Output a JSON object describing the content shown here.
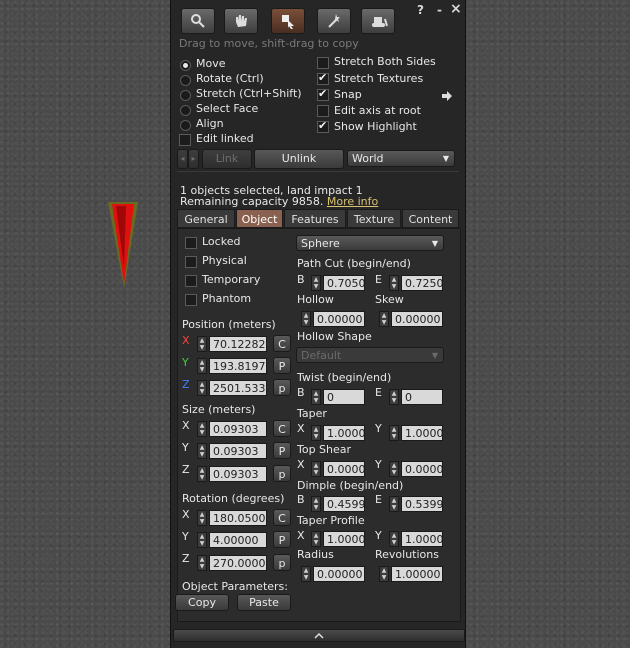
{
  "header": {
    "help": "?",
    "minimize": "-",
    "close": "×",
    "hint": "Drag to move, shift-drag to copy"
  },
  "modes": [
    {
      "label": "Move",
      "selected": true
    },
    {
      "label": "Rotate (Ctrl)",
      "selected": false
    },
    {
      "label": "Stretch (Ctrl+Shift)",
      "selected": false
    },
    {
      "label": "Select Face",
      "selected": false
    },
    {
      "label": "Align",
      "selected": false
    }
  ],
  "options_left": [
    {
      "label": "Edit linked",
      "checked": false
    }
  ],
  "options_right": [
    {
      "label": "Stretch Both Sides",
      "checked": false
    },
    {
      "label": "Stretch Textures",
      "checked": true
    },
    {
      "label": "Snap",
      "checked": true
    },
    {
      "label": "Edit axis at root",
      "checked": false
    },
    {
      "label": "Show Highlight",
      "checked": true
    }
  ],
  "link_bar": {
    "link": "Link",
    "unlink": "Unlink",
    "ruler": "World"
  },
  "status": {
    "selected": "1 objects selected, land impact 1",
    "capacity": "Remaining capacity 9858.",
    "more_info": "More info"
  },
  "tabs": [
    {
      "label": "General",
      "active": false
    },
    {
      "label": "Object",
      "active": true
    },
    {
      "label": "Features",
      "active": false
    },
    {
      "label": "Texture",
      "active": false
    },
    {
      "label": "Content",
      "active": false
    }
  ],
  "flags": [
    {
      "label": "Locked",
      "checked": false
    },
    {
      "label": "Physical",
      "checked": false
    },
    {
      "label": "Temporary",
      "checked": false
    },
    {
      "label": "Phantom",
      "checked": false
    }
  ],
  "position": {
    "title": "Position (meters)",
    "x": "70.12282",
    "y": "193.8197",
    "z": "2501.533",
    "axis": [
      "X",
      "Y",
      "Z"
    ],
    "axis_colors": [
      "#ff4040",
      "#40d040",
      "#4080ff"
    ],
    "btns": [
      "C",
      "P",
      "p"
    ]
  },
  "size": {
    "title": "Size (meters)",
    "x": "0.09303",
    "y": "0.09303",
    "z": "0.09303",
    "axis": [
      "X",
      "Y",
      "Z"
    ],
    "btns": [
      "C",
      "P",
      "p"
    ]
  },
  "rotation": {
    "title": "Rotation (degrees)",
    "x": "180.0500",
    "y": "4.00000",
    "z": "270.00000",
    "axis": [
      "X",
      "Y",
      "Z"
    ],
    "btns": [
      "C",
      "P",
      "p"
    ]
  },
  "object_params": {
    "title": "Object Parameters:",
    "copy": "Copy",
    "paste": "Paste"
  },
  "shape": {
    "type": "Sphere",
    "path_cut": {
      "title": "Path Cut (begin/end)",
      "b_label": "B",
      "b": "0.7050",
      "e_label": "E",
      "e": "0.7250"
    },
    "hollow": {
      "title": "Hollow",
      "value": "0.00000"
    },
    "skew": {
      "title": "Skew",
      "value": "0.00000"
    },
    "hollow_shape": {
      "title": "Hollow Shape",
      "value": "Default"
    },
    "twist": {
      "title": "Twist (begin/end)",
      "b_label": "B",
      "b": "0",
      "e_label": "E",
      "e": "0"
    },
    "taper": {
      "title": "Taper",
      "x_label": "X",
      "x": "1.0000",
      "y_label": "Y",
      "y": "1.0000"
    },
    "top_shear": {
      "title": "Top Shear",
      "x_label": "X",
      "x": "0.0000",
      "y_label": "Y",
      "y": "0.0000"
    },
    "dimple": {
      "title": "Dimple (begin/end)",
      "b_label": "B",
      "b": "0.4599",
      "e_label": "E",
      "e": "0.5399"
    },
    "taper_profile": {
      "title": "Taper Profile",
      "x_label": "X",
      "x": "1.0000",
      "y_label": "Y",
      "y": "1.0000"
    },
    "radius": {
      "title": "Radius",
      "value": "0.00000"
    },
    "revolutions": {
      "title": "Revolutions",
      "value": "1.00000"
    }
  },
  "colors": {
    "panel": "#262626",
    "active_tab": "#8a6150",
    "link": "#d8c070"
  }
}
